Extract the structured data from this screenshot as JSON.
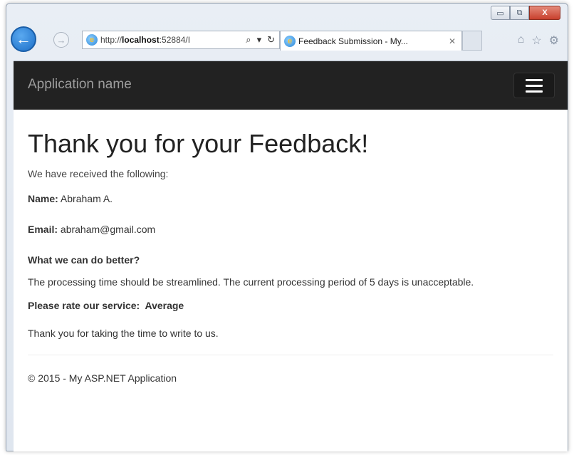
{
  "browser": {
    "address_prefix": "http://",
    "address_host": "localhost",
    "address_rest": ":52884/I",
    "search_glyph": "⌕",
    "dropdown_glyph": "▾",
    "refresh_glyph": "↻",
    "tab_title": "Feedback Submission - My...",
    "tab_close": "✕",
    "caption_close": "X"
  },
  "navbar": {
    "brand": "Application name"
  },
  "page": {
    "heading": "Thank you for your Feedback!",
    "intro": "We have received the following:",
    "name_label": "Name:",
    "name_value": "Abraham A.",
    "email_label": "Email:",
    "email_value": "abraham@gmail.com",
    "better_question": "What we can do better?",
    "better_answer": "The processing time should be streamlined. The current processing period of 5 days is unacceptable.",
    "rate_label": "Please rate our service:",
    "rate_value": "Average",
    "closing": "Thank you for taking the time to write to us."
  },
  "footer": {
    "text": "© 2015 - My ASP.NET Application"
  },
  "icons": {
    "back": "back-arrow-icon",
    "forward": "forward-arrow-icon",
    "home": "home-icon",
    "favorites": "star-icon",
    "settings": "gear-icon"
  }
}
